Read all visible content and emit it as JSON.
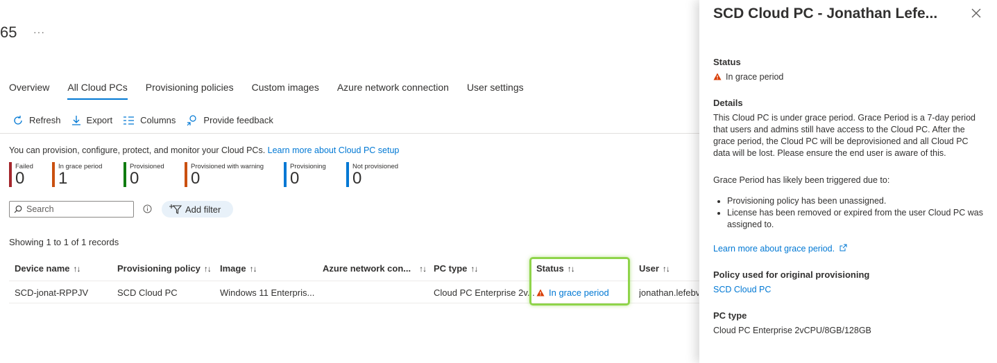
{
  "header": {
    "title_fragment": "65",
    "more_label": "···"
  },
  "tabs": [
    {
      "label": "Overview",
      "active": false
    },
    {
      "label": "All Cloud PCs",
      "active": true
    },
    {
      "label": "Provisioning policies",
      "active": false
    },
    {
      "label": "Custom images",
      "active": false
    },
    {
      "label": "Azure network connection",
      "active": false
    },
    {
      "label": "User settings",
      "active": false
    }
  ],
  "toolbar": {
    "refresh": "Refresh",
    "export": "Export",
    "columns": "Columns",
    "feedback": "Provide feedback"
  },
  "intro": {
    "text": "You can provision, configure, protect, and monitor your Cloud PCs. ",
    "link": "Learn more about Cloud PC setup"
  },
  "tiles": [
    {
      "label": "Failed",
      "count": "0",
      "color": "#a4262c"
    },
    {
      "label": "In grace period",
      "count": "1",
      "color": "#ca5010"
    },
    {
      "label": "Provisioned",
      "count": "0",
      "color": "#107c10"
    },
    {
      "label": "Provisioned with warning",
      "count": "0",
      "color": "#ca5010"
    },
    {
      "label": "Provisioning",
      "count": "0",
      "color": "#0078d4"
    },
    {
      "label": "Not provisioned",
      "count": "0",
      "color": "#0078d4"
    }
  ],
  "search": {
    "placeholder": "Search"
  },
  "filter": {
    "label": "Add filter"
  },
  "showing": "Showing 1 to 1 of 1 records",
  "table": {
    "sort_glyph": "↑↓",
    "headers": [
      "Device name",
      "Provisioning policy",
      "Image",
      "Azure network con...",
      "PC type",
      "Status",
      "User"
    ],
    "row": {
      "device": "SCD-jonat-RPPJV",
      "policy": "SCD Cloud PC",
      "image": "Windows 11 Enterpris...",
      "network": "",
      "pc_type": "Cloud PC Enterprise 2v...",
      "status": "In grace period",
      "user": "jonathan.lefebv"
    }
  },
  "panel": {
    "title": "SCD Cloud PC - Jonathan Lefe...",
    "status_heading": "Status",
    "status_value": "In grace period",
    "details_heading": "Details",
    "details_text": "This Cloud PC is under grace period. Grace Period is a 7-day period that users and admins still have access to the Cloud PC. After the grace period, the Cloud PC will be deprovisioned and all Cloud PC data will be lost. Please ensure the end user is aware of this.",
    "trigger_text": "Grace Period has likely been triggered due to:",
    "bullets": [
      "Provisioning policy has been unassigned.",
      "License has been removed or expired from the user Cloud PC was assigned to."
    ],
    "learn_more": "Learn more about grace period.",
    "policy_heading": "Policy used for original provisioning",
    "policy_link": "SCD Cloud PC",
    "pctype_heading": "PC type",
    "pctype_value": "Cloud PC Enterprise 2vCPU/8GB/128GB"
  },
  "colors": {
    "accent": "#0078d4",
    "warning": "#d83b01",
    "highlight": "#8fd44a"
  },
  "icons": [
    "refresh-icon",
    "download-icon",
    "columns-icon",
    "feedback-icon",
    "search-icon",
    "info-icon",
    "filter-icon",
    "warning-icon",
    "external-link-icon",
    "close-icon"
  ]
}
